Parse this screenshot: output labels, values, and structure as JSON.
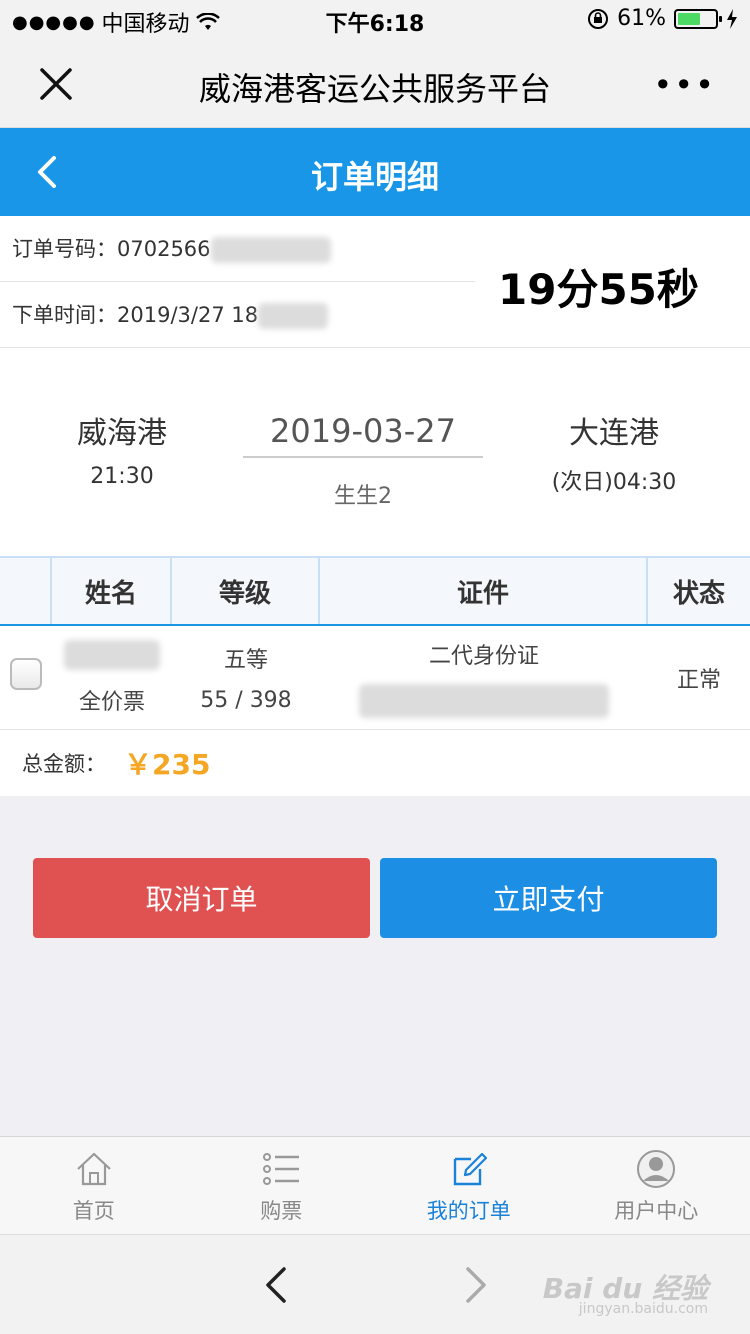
{
  "status_bar": {
    "signal_dots": "●●●●●",
    "carrier": "中国移动",
    "time": "下午6:18",
    "battery_percent": "61%",
    "battery_level": 0.61
  },
  "wx_header": {
    "title": "威海港客运公共服务平台",
    "more": "•••"
  },
  "navbar": {
    "title": "订单明细"
  },
  "order": {
    "number_label": "订单号码：",
    "number_value": "0702566",
    "time_label": "下单时间：",
    "time_value": "2019/3/27 18",
    "countdown": "19分55秒"
  },
  "voyage": {
    "from_port": "威海港",
    "from_time": "21:30",
    "date": "2019-03-27",
    "ship": "生生2",
    "to_port": "大连港",
    "to_time": "(次日)04:30"
  },
  "passenger_table": {
    "headers": [
      "姓名",
      "等级",
      "证件",
      "状态"
    ],
    "rows": [
      {
        "ticket_type": "全价票",
        "class": "五等",
        "seat": "55 / 398",
        "id_type": "二代身份证",
        "status": "正常"
      }
    ]
  },
  "total": {
    "label": "总金额：",
    "amount": "￥235"
  },
  "buttons": {
    "cancel": "取消订单",
    "pay": "立即支付"
  },
  "tabs": [
    {
      "label": "首页",
      "icon": "home-icon"
    },
    {
      "label": "购票",
      "icon": "list-icon"
    },
    {
      "label": "我的订单",
      "icon": "edit-icon",
      "active": true
    },
    {
      "label": "用户中心",
      "icon": "user-icon"
    }
  ],
  "watermark": {
    "text": "Bai du 经验",
    "sub": "jingyan.baidu.com"
  },
  "colors": {
    "primary": "#1a96e8",
    "danger": "#e05252",
    "price": "#f5a623",
    "battery": "#4cd964"
  }
}
